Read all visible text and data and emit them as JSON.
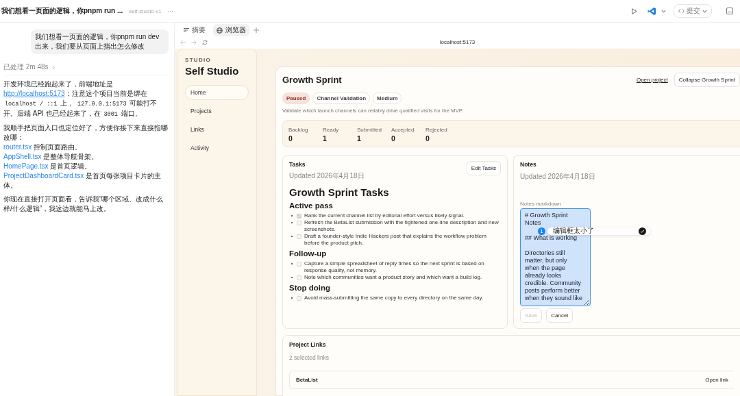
{
  "thread": {
    "title": "我们想看一页面的逻辑，你pnpm run ...",
    "project": "self-studio-v1",
    "more": "···"
  },
  "toolbar": {
    "commit_label": "提交"
  },
  "chat": {
    "user_message": "我们想看一页面的逻辑，你pnpm run dev出来，我们要从页面上指出怎么修改",
    "processed": "已处理 2m 48s",
    "paragraph_1": [
      {
        "kind": "text",
        "text": "开发环境已经跑起来了，前端地址是 "
      },
      {
        "kind": "link",
        "text": "http://localhost:5173"
      },
      {
        "kind": "text",
        "text": "；注意这个项目当前是绑在 "
      },
      {
        "kind": "code",
        "text": "localhost / ::1"
      },
      {
        "kind": "text",
        "text": " 上， "
      },
      {
        "kind": "code",
        "text": "127.0.0.1:5173"
      },
      {
        "kind": "text",
        "text": " 可能打不开。后端 API 也已经起来了，在 "
      },
      {
        "kind": "code",
        "text": "3001"
      },
      {
        "kind": "text",
        "text": " 端口。"
      }
    ],
    "paragraph_2": "我顺手把页面入口也定位好了，方便你接下来直接指哪改哪：",
    "files": [
      {
        "file": "router.tsx",
        "note": " 控制页面路由。"
      },
      {
        "file": "AppShell.tsx",
        "note": " 是整体导航骨架。"
      },
      {
        "file": "HomePage.tsx",
        "note": " 是首页逻辑。"
      },
      {
        "file": "ProjectDashboardCard.tsx",
        "note": " 是首页每张项目卡片的主体。"
      }
    ],
    "paragraph_3": "你现在直接打开页面看，告诉我“哪个区域、改成什么样/什么逻辑”，我这边就能马上改。"
  },
  "browser": {
    "tabs": [
      {
        "label": "摘要",
        "selected": false
      },
      {
        "label": "浏览器",
        "selected": true
      }
    ],
    "address": "localhost:5173"
  },
  "sidebar": {
    "eyebrow": "STUDIO",
    "title": "Self Studio",
    "items": [
      {
        "label": "Home",
        "selected": true
      },
      {
        "label": "Projects",
        "selected": false
      },
      {
        "label": "Links",
        "selected": false
      },
      {
        "label": "Activity",
        "selected": false
      }
    ]
  },
  "project": {
    "title": "Growth Sprint",
    "open_link": "Open project",
    "collapse_button": "Collapse Growth Sprint",
    "tags": [
      {
        "label": "Paused",
        "kind": "status"
      },
      {
        "label": "Channel Validation",
        "kind": "plain"
      },
      {
        "label": "Medium",
        "kind": "plain"
      }
    ],
    "description": "Validate which launch channels can reliably drive qualified visits for the MVP.",
    "stats": [
      {
        "label": "Backlog",
        "value": "0"
      },
      {
        "label": "Ready",
        "value": "1"
      },
      {
        "label": "Submitted",
        "value": "1"
      },
      {
        "label": "Accepted",
        "value": "0"
      },
      {
        "label": "Rejected",
        "value": "0"
      }
    ]
  },
  "tasks": {
    "title": "Tasks",
    "edit_button": "Edit Tasks",
    "updated": "Updated 2026年4月18日",
    "heading": "Growth Sprint Tasks",
    "sections": [
      {
        "heading": "Active pass",
        "items": [
          {
            "text": "Rank the current channel list by editorial effort versus likely signal.",
            "checked": true
          },
          {
            "text": "Refresh the BetaList submission with the tightened one-line description and new screenshots.",
            "checked": false
          },
          {
            "text": "Draft a founder-style Indie Hackers post that explains the workflow problem before the product pitch.",
            "checked": false
          }
        ]
      },
      {
        "heading": "Follow-up",
        "items": [
          {
            "text": "Capture a simple spreadsheet of reply times so the next sprint is based on response quality, not memory.",
            "checked": false
          },
          {
            "text": "Note which communities want a product story and which want a build log.",
            "checked": false
          }
        ]
      },
      {
        "heading": "Stop doing",
        "items": [
          {
            "text": "Avoid mass-submitting the same copy to every directory on the same day.",
            "checked": false
          }
        ]
      }
    ]
  },
  "notes": {
    "title": "Notes",
    "updated": "Updated 2026年4月18日",
    "field_label": "Notes markdown",
    "value": "# Growth Sprint Notes\n\n## What is working\n\nDirectories still matter, but only when the page already looks credible. Community posts perform better when they sound like",
    "save_button": "Save",
    "save_disabled": true,
    "cancel_button": "Cancel"
  },
  "comment": {
    "badge": "1",
    "text": "编辑框太小了"
  },
  "links": {
    "title": "Project Links",
    "count": "2 selected links",
    "rows": [
      {
        "name": "BetaList",
        "action": "Open link"
      }
    ]
  }
}
